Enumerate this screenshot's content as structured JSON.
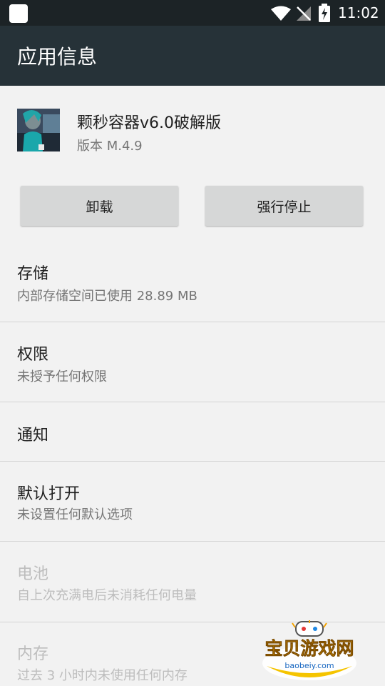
{
  "status_bar": {
    "time": "11:02"
  },
  "app_bar": {
    "title": "应用信息"
  },
  "app": {
    "name": "颗秒容器v6.0破解版",
    "version": "版本 M.4.9"
  },
  "buttons": {
    "uninstall": "卸载",
    "force_stop": "强行停止"
  },
  "prefs": [
    {
      "title": "存储",
      "summary": "内部存储空间已使用 28.89 MB"
    },
    {
      "title": "权限",
      "summary": "未授予任何权限"
    },
    {
      "title": "通知"
    },
    {
      "title": "默认打开",
      "summary": "未设置任何默认选项"
    },
    {
      "title": "电池",
      "summary": "自上次充满电后未消耗任何电量"
    },
    {
      "title": "内存",
      "summary": "过去 3 小时内未使用任何内存"
    }
  ],
  "watermark": {
    "name": "宝贝游戏网",
    "url": "baobeiy.com"
  }
}
